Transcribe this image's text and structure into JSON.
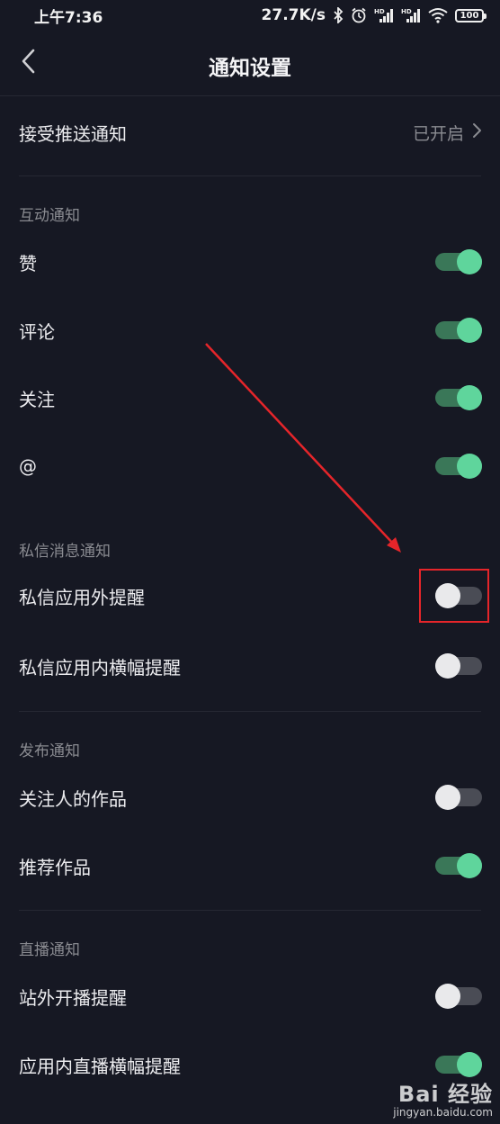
{
  "status_bar": {
    "time": "上午7:36",
    "network_speed": "27.7K/s",
    "battery": "100",
    "icons": [
      "bluetooth-icon",
      "alarm-icon",
      "hd-signal-icon",
      "hd-signal-icon",
      "wifi-icon",
      "battery-icon"
    ]
  },
  "header": {
    "title": "通知设置",
    "back_icon": "chevron-left-icon"
  },
  "push": {
    "label": "接受推送通知",
    "value": "已开启",
    "chevron_icon": "chevron-right-icon"
  },
  "sections": [
    {
      "title": "互动通知",
      "items": [
        {
          "label": "赞",
          "enabled": true
        },
        {
          "label": "评论",
          "enabled": true
        },
        {
          "label": "关注",
          "enabled": true
        },
        {
          "label": "@",
          "enabled": true
        }
      ]
    },
    {
      "title": "私信消息通知",
      "items": [
        {
          "label": "私信应用外提醒",
          "enabled": false
        },
        {
          "label": "私信应用内横幅提醒",
          "enabled": false
        }
      ]
    },
    {
      "title": "发布通知",
      "items": [
        {
          "label": "关注人的作品",
          "enabled": false
        },
        {
          "label": "推荐作品",
          "enabled": true
        }
      ]
    },
    {
      "title": "直播通知",
      "items": [
        {
          "label": "站外开播提醒",
          "enabled": false
        },
        {
          "label": "应用内直播横幅提醒",
          "enabled": true
        }
      ]
    }
  ],
  "colors": {
    "background": "#161823",
    "toggle_on_knob": "#5fd59c",
    "toggle_on_track": "#3a7758",
    "toggle_off_track": "#4a4c55",
    "annotation": "#e5252a"
  },
  "watermark": {
    "logo": "Bai 经验",
    "sub": "jingyan.baidu.com"
  }
}
